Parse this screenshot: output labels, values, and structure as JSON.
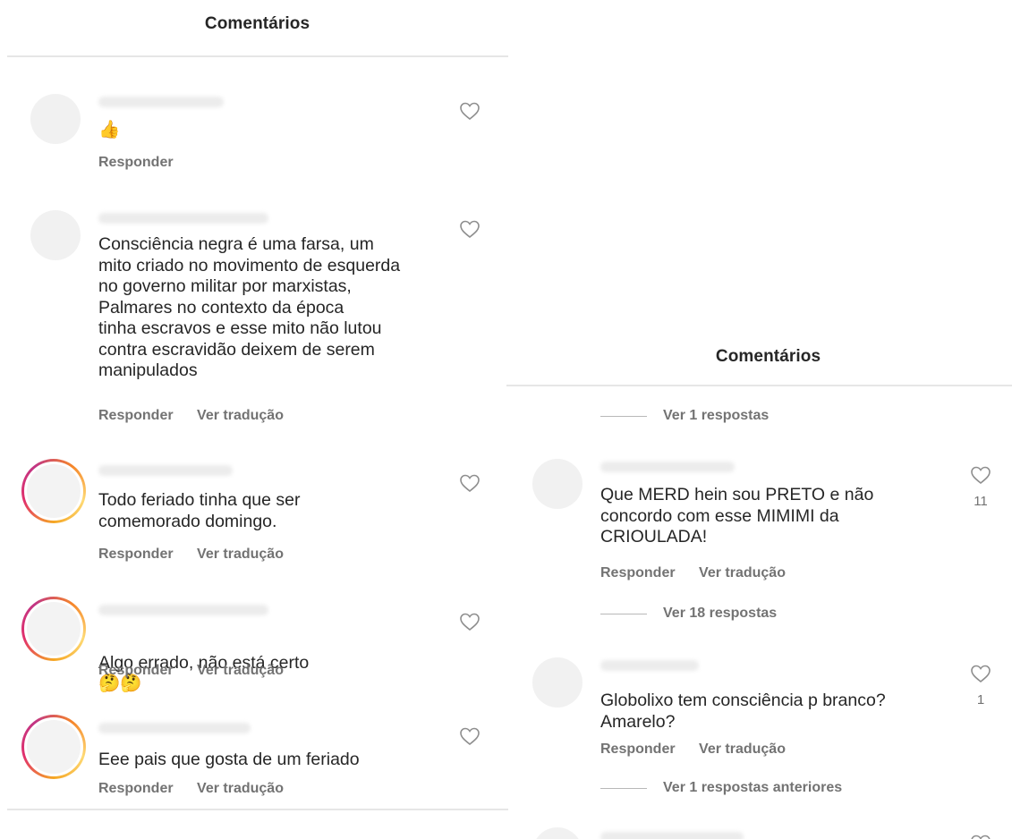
{
  "left": {
    "header": {
      "title": "Comentários"
    },
    "comments": [
      {
        "text": "👍",
        "actions": [
          "Responder"
        ]
      },
      {
        "text": "Consciência negra é uma farsa, um\nmito criado no movimento de esquerda\nno governo militar por marxistas,\nPalmares no contexto da época\ntinha escravos e esse mito não lutou\ncontra escravidão deixem de serem\nmanipulados",
        "actions": [
          "Responder",
          "Ver tradução"
        ]
      },
      {
        "text": "Todo feriado tinha que ser\ncomemorado domingo.",
        "actions": [
          "Responder",
          "Ver tradução"
        ]
      },
      {
        "text": "Algo errado, não está certo",
        "emoji": "🤔🤔",
        "actions": [
          "Responder",
          "Ver tradução"
        ]
      },
      {
        "text": "Eee pais que gosta de um feriado",
        "actions": [
          "Responder",
          "Ver tradução"
        ]
      }
    ]
  },
  "right": {
    "header": {
      "title": "Comentários"
    },
    "replies_top": "Ver 1 respostas",
    "comments": [
      {
        "text": "Que MERD hein sou PRETO e não\nconcordo com esse MIMIMI da\nCRIOULADA!",
        "likes": "11",
        "actions": [
          "Responder",
          "Ver tradução"
        ],
        "replies": "Ver 18 respostas"
      },
      {
        "text": "Globolixo tem consciência p branco?\nAmarelo?",
        "likes": "1",
        "actions": [
          "Responder",
          "Ver tradução"
        ],
        "replies": "Ver 1 respostas anteriores"
      }
    ]
  }
}
